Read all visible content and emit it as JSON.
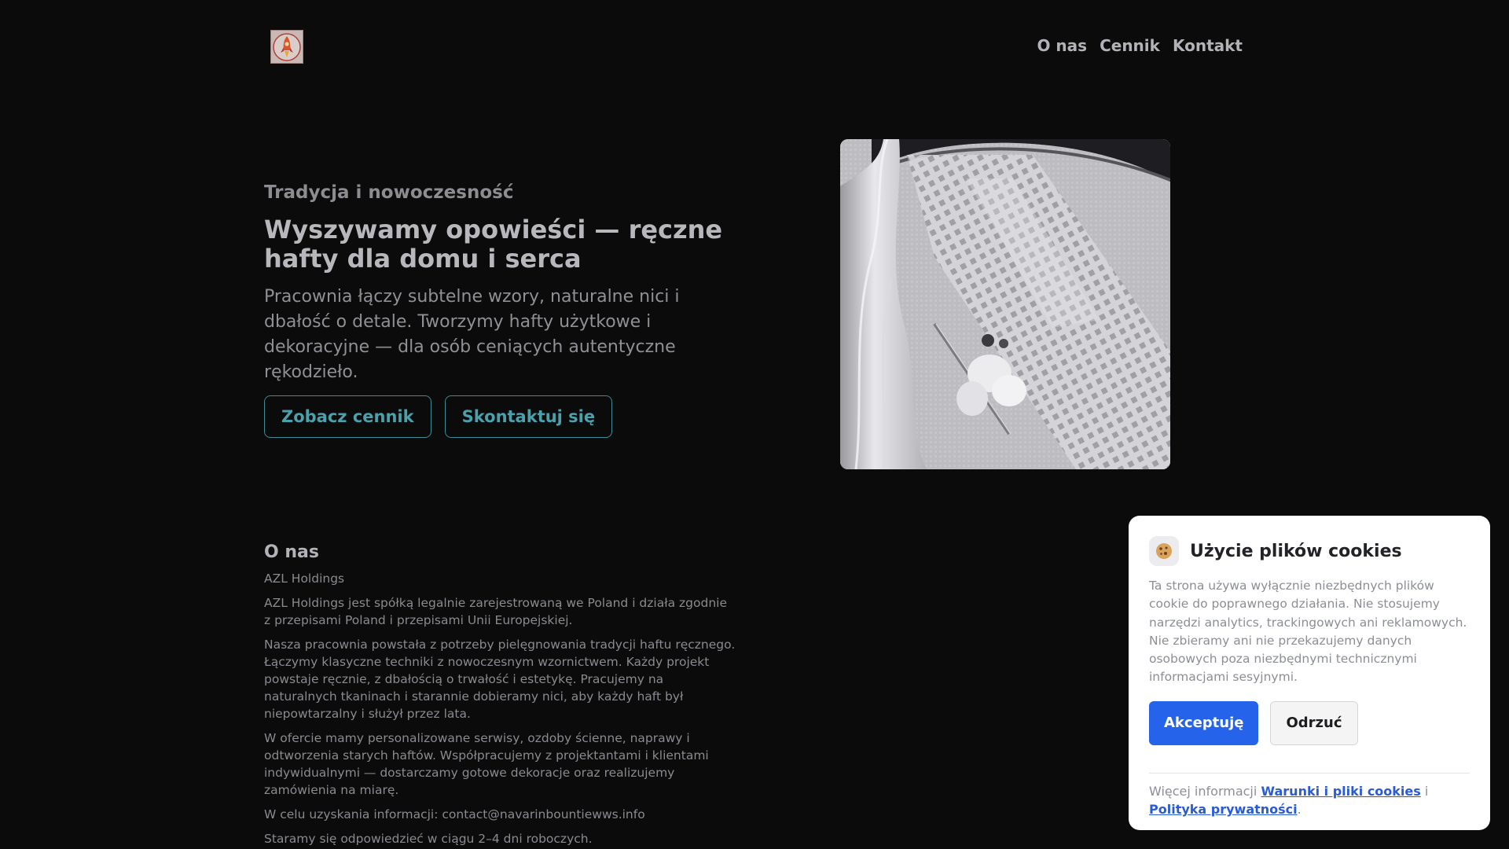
{
  "header": {
    "logo_icon": "rocket-emblem-icon",
    "nav": [
      {
        "label": "O nas"
      },
      {
        "label": "Cennik"
      },
      {
        "label": "Kontakt"
      }
    ]
  },
  "hero": {
    "kicker": "Tradycja i nowoczesność",
    "title": "Wyszywamy opowieści — ręczne hafty dla domu i serca",
    "description": "Pracownia łączy subtelne wzory, naturalne nici i dbałość o detale. Tworzymy hafty użytkowe i dekoracyjne — dla osób ceniących autentyczne rękodzieło.",
    "primary_button": "Zobacz cennik",
    "secondary_button": "Skontaktuj się",
    "image_alt": "embroidery-on-hoop-photo"
  },
  "about": {
    "heading": "O nas",
    "company": "AZL Holdings",
    "paragraphs": [
      "AZL Holdings jest spółką legalnie zarejestrowaną we Poland i działa zgodnie z przepisami Poland i przepisami Unii Europejskiej.",
      "Nasza pracownia powstała z potrzeby pielęgnowania tradycji haftu ręcznego. Łączymy klasyczne techniki z nowoczesnym wzornictwem. Każdy projekt powstaje ręcznie, z dbałością o trwałość i estetykę. Pracujemy na naturalnych tkaninach i starannie dobieramy nici, aby każdy haft był niepowtarzalny i służył przez lata.",
      "W ofercie mamy personalizowane serwisy, ozdoby ścienne, naprawy i odtworzenia starych haftów. Współpracujemy z projektantami i klientami indywidualnymi — dostarczamy gotowe dekoracje oraz realizujemy zamówienia na miarę.",
      "W celu uzyskania informacji: contact@navarinbountiewws.info",
      "Staramy się odpowiedzieć w ciągu 2–4 dni roboczych."
    ]
  },
  "cookie_banner": {
    "icon": "cookie-icon",
    "title": "Użycie plików cookies",
    "text": "Ta strona używa wyłącznie niezbędnych plików cookie do poprawnego działania. Nie stosujemy narzędzi analytics, trackingowych ani reklamowych. Nie zbieramy ani nie przekazujemy danych osobowych poza niezbędnymi technicznymi informacjami sesyjnymi.",
    "accept_label": "Akceptuję",
    "reject_label": "Odrzuć",
    "more_prefix": "Więcej informacji",
    "terms_link": "Warunki i pliki cookies",
    "conjunction": "i",
    "privacy_link": "Polityka prywatności",
    "suffix": "."
  },
  "colors": {
    "background": "#0b0b0c",
    "accent_teal": "#4aa0ab",
    "accept_blue": "#2563eb",
    "link_blue": "#2a5bd7"
  }
}
